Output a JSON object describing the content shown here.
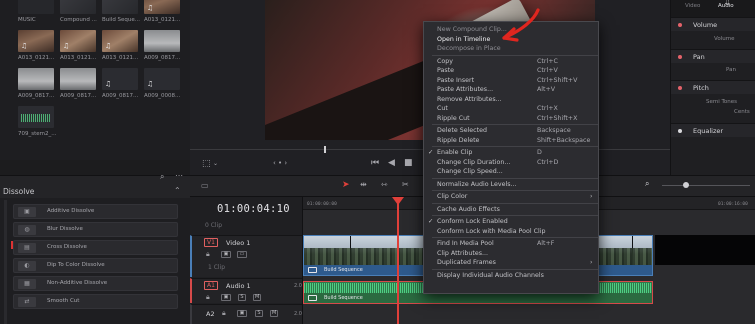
{
  "media_pool": {
    "clips": [
      {
        "label": "MUSIC",
        "kind": "dark"
      },
      {
        "label": "Compound ...",
        "kind": "compound"
      },
      {
        "label": "Build Seque...",
        "kind": "compound"
      },
      {
        "label": "A013_0121...",
        "kind": "warm"
      },
      {
        "label": "A013_0121...",
        "kind": "warm"
      },
      {
        "label": "A013_0121...",
        "kind": "warm2"
      },
      {
        "label": "A013_0121...",
        "kind": "warm2"
      },
      {
        "label": "A009_0817...",
        "kind": "grey"
      },
      {
        "label": "A009_0817...",
        "kind": "grey"
      },
      {
        "label": "A009_0817...",
        "kind": "grey"
      },
      {
        "label": "A009_0817...",
        "kind": "audio"
      },
      {
        "label": "A009_0008...",
        "kind": "audio"
      },
      {
        "label": "709_stem2_...",
        "kind": "wave"
      }
    ]
  },
  "inspector": {
    "tabs": [
      "Video",
      "Audio"
    ],
    "sections": [
      {
        "label": "Volume",
        "sub": "Volume"
      },
      {
        "label": "Pan",
        "sub": "Pan"
      },
      {
        "label": "Pitch",
        "sub": "Semi Tones",
        "sub2": "Cents"
      },
      {
        "label": "Equalizer"
      }
    ]
  },
  "effects": {
    "title": "Dissolve",
    "items": [
      "Additive Dissolve",
      "Blur Dissolve",
      "Cross Dissolve",
      "Dip To Color Dissolve",
      "Non-Additive Dissolve",
      "Smooth Cut"
    ]
  },
  "timeline": {
    "timecode": "01:00:04:10",
    "ruler": [
      "01:00:00:00",
      "01:00:16:00"
    ],
    "tracks": {
      "empty_clip_label": "0 Clip",
      "video": {
        "id": "V1",
        "name": "Video 1",
        "count": "1 Clip"
      },
      "audio1": {
        "id": "A1",
        "name": "Audio 1",
        "level": "2.0"
      },
      "audio2": {
        "id": "A2",
        "level": "2.0"
      }
    },
    "video_clip_label": "Build Sequence",
    "audio_clip_label": "Build Sequence"
  },
  "context_menu": {
    "groups": [
      [
        {
          "label": "New Compound Clip...",
          "dim": true
        },
        {
          "label": "Open in Timeline",
          "highlight": true
        },
        {
          "label": "Decompose in Place",
          "dim": true
        }
      ],
      [
        {
          "label": "Copy",
          "shortcut": "Ctrl+C"
        },
        {
          "label": "Paste",
          "shortcut": "Ctrl+V"
        },
        {
          "label": "Paste Insert",
          "shortcut": "Ctrl+Shift+V"
        },
        {
          "label": "Paste Attributes...",
          "shortcut": "Alt+V"
        },
        {
          "label": "Remove Attributes..."
        },
        {
          "label": "Cut",
          "shortcut": "Ctrl+X"
        },
        {
          "label": "Ripple Cut",
          "shortcut": "Ctrl+Shift+X"
        }
      ],
      [
        {
          "label": "Delete Selected",
          "shortcut": "Backspace"
        },
        {
          "label": "Ripple Delete",
          "shortcut": "Shift+Backspace"
        }
      ],
      [
        {
          "label": "Enable Clip",
          "shortcut": "D",
          "checked": true
        },
        {
          "label": "Change Clip Duration...",
          "shortcut": "Ctrl+D"
        },
        {
          "label": "Change Clip Speed..."
        }
      ],
      [
        {
          "label": "Normalize Audio Levels..."
        }
      ],
      [
        {
          "label": "Clip Color",
          "submenu": true
        }
      ],
      [
        {
          "label": "Cache Audio Effects"
        }
      ],
      [
        {
          "label": "Conform Lock Enabled",
          "checked": true
        },
        {
          "label": "Conform Lock with Media Pool Clip"
        }
      ],
      [
        {
          "label": "Find In Media Pool",
          "shortcut": "Alt+F"
        },
        {
          "label": "Clip Attributes..."
        },
        {
          "label": "Duplicated Frames",
          "submenu": true
        }
      ],
      [
        {
          "label": "Display Individual Audio Channels"
        }
      ]
    ]
  },
  "colors": {
    "accent_red": "#e0403a",
    "video_clip": "#2e5a8c",
    "audio_clip": "#2f7a4b"
  }
}
